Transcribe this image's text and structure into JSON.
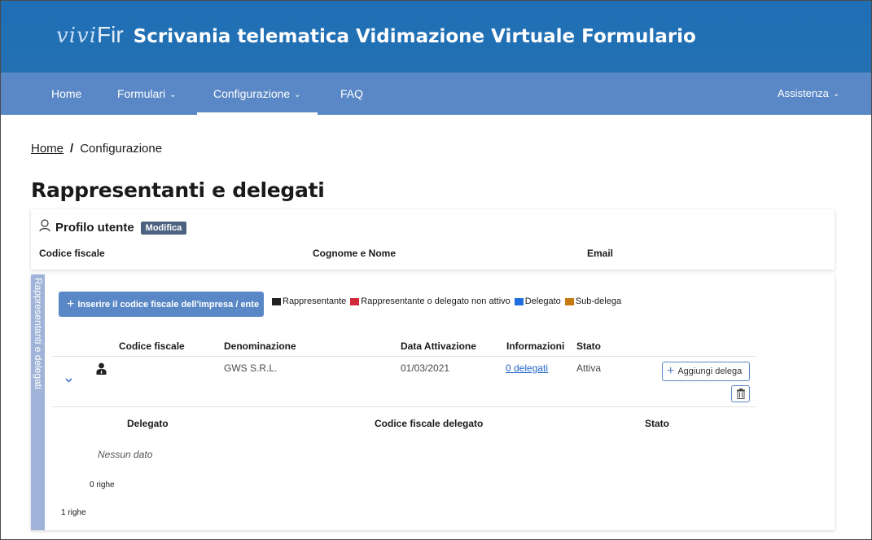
{
  "header": {
    "logo_vivi": "vivi",
    "logo_fir": "Fir",
    "title": "Scrivania telematica Vidimazione Virtuale Formulario"
  },
  "nav": {
    "items": [
      {
        "label": "Home"
      },
      {
        "label": "Formulari"
      },
      {
        "label": "Configurazione"
      },
      {
        "label": "FAQ"
      }
    ],
    "right": {
      "label": "Assistenza"
    },
    "chevron": "⌄"
  },
  "breadcrumb": {
    "home": "Home",
    "sep": "/",
    "current": "Configurazione"
  },
  "page_title": "Rappresentanti e delegati",
  "profile": {
    "label": "Profilo utente",
    "edit_badge": "Modifica",
    "columns": [
      "Codice fiscale",
      "Cognome e Nome",
      "Email"
    ]
  },
  "delegates": {
    "side_tab": "Rappresentanti e delegati",
    "insert_button": "Inserire il codice fiscale dell'impresa / ente",
    "legend": [
      {
        "label": "Rappresentante",
        "color": "#222222"
      },
      {
        "label": "Rappresentante o delegato non attivo",
        "color": "#d22a3a"
      },
      {
        "label": "Delegato",
        "color": "#1e6fe0"
      },
      {
        "label": "Sub-delega",
        "color": "#c77a12"
      }
    ],
    "columns": [
      "Codice fiscale",
      "Denominazione",
      "Data Attivazione",
      "Informazioni",
      "Stato"
    ],
    "rows": [
      {
        "codice_fiscale": "",
        "denominazione": "GWS S.R.L.",
        "data_attivazione": "01/03/2021",
        "informazioni": "0 delegati",
        "stato": "Attiva",
        "add_delega": "Aggiungi delega"
      }
    ],
    "sub_table": {
      "columns": [
        "Delegato",
        "Codice fiscale delegato",
        "Stato"
      ],
      "empty": "Nessun dato",
      "row_count": "0 righe"
    },
    "row_count": "1 righe"
  }
}
